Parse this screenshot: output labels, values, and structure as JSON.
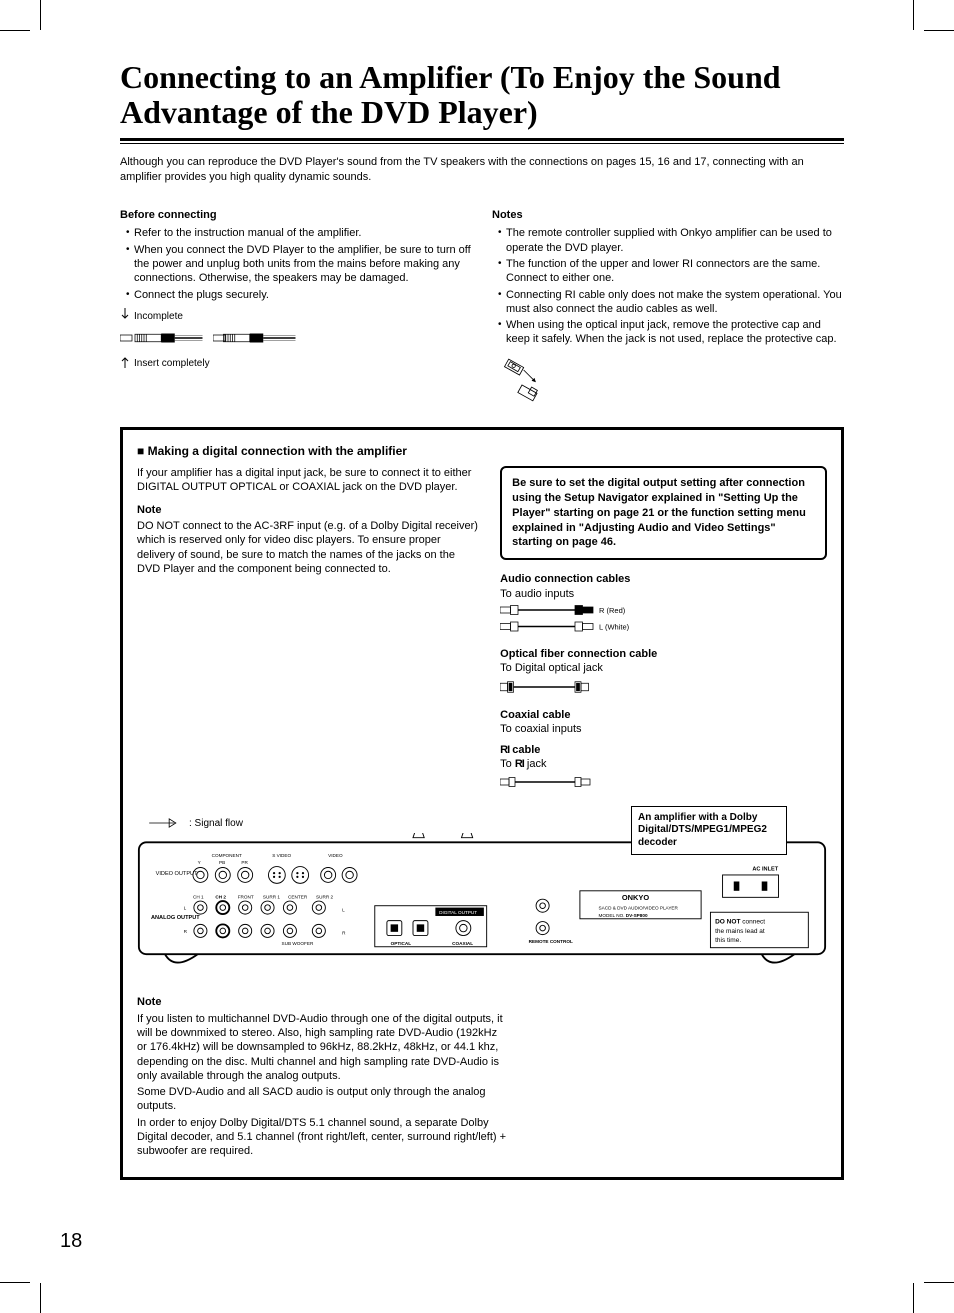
{
  "title": "Connecting to an Amplifier (To Enjoy the Sound Advantage of the DVD Player)",
  "intro": "Although you can reproduce the DVD Player's sound from the TV speakers with the connections on pages 15, 16 and 17, connecting with an amplifier provides you high quality dynamic sounds.",
  "before": {
    "heading": "Before connecting",
    "items": [
      "Refer to the instruction manual of the amplifier.",
      "When you connect the DVD Player to the amplifier, be sure to turn off the power and unplug both units from the mains before making any connections. Otherwise, the speakers may be damaged.",
      "Connect the plugs securely."
    ],
    "plug_incomplete": "Incomplete",
    "plug_complete": "Insert completely"
  },
  "notes": {
    "heading": "Notes",
    "items": [
      "The remote controller supplied with Onkyo amplifier can be used to operate the DVD player.",
      "The function of the upper and lower RI connectors are the same. Connect to either one.",
      "Connecting RI cable only does not make the system operational. You must also connect the audio cables as well.",
      "When using the optical input jack, remove the protective cap and keep it safely. When the jack is not used, replace the protective cap."
    ]
  },
  "digital": {
    "heading": "Making a digital connection with the amplifier",
    "body": "If your amplifier has a digital input jack, be sure to connect it to either DIGITAL OUTPUT OPTICAL or COAXIAL jack on the DVD player.",
    "note_label": "Note",
    "note_body": "DO NOT connect to the AC-3RF input (e.g. of a Dolby Digital receiver) which is reserved only for video disc players. To ensure proper delivery of sound, be sure to match the names of the jacks on the DVD Player and the component being connected to.",
    "callout": "Be sure to set the digital output setting after connection using the Setup Navigator explained in \"Setting Up the Player\" starting on page 21 or the function setting menu explained in \"Adjusting Audio and Video Settings\" starting on page 46.",
    "cables": {
      "audio_title": "Audio connection cables",
      "audio_sub": "To audio inputs",
      "r_label": "R (Red)",
      "l_label": "L (White)",
      "optical_title": "Optical fiber connection cable",
      "optical_sub": "To Digital optical jack",
      "coax_title": "Coaxial cable",
      "coax_sub": "To coaxial inputs",
      "ri_title": "RI cable",
      "ri_sub": "To RI jack"
    },
    "signal_flow": ": Signal flow",
    "amp_box": "An amplifier with a Dolby Digital/DTS/MPEG1/MPEG2 decoder"
  },
  "panel": {
    "brand": "ONKYO",
    "desc": "SACD & DVD AUDIO/VIDEO PLAYER",
    "model_label": "MODEL NO.",
    "model": "DV-SP800",
    "ac_inlet": "AC INLET",
    "do_not": "DO NOT connect the mains lead at this time.",
    "video_output": "VIDEO OUTPUT",
    "analog_output": "ANALOG OUTPUT",
    "digital_output": "DIGITAL OUTPUT",
    "remote_control": "REMOTE CONTROL",
    "optical": "OPTICAL",
    "coaxial": "COAXIAL",
    "labels": {
      "component": "COMPONENT",
      "y": "Y",
      "pb": "PB",
      "pr": "PR",
      "svideo": "S VIDEO",
      "video": "VIDEO",
      "ch1": "CH 1",
      "ch2": "CH 2",
      "front": "FRONT",
      "surr1": "SURR 1",
      "center": "CENTER",
      "surr2": "SURR 2",
      "l": "L",
      "r": "R",
      "sub": "SUB WOOFER"
    }
  },
  "bottom_note": {
    "heading": "Note",
    "p1": "If you listen to multichannel DVD-Audio through one of the digital outputs, it will be downmixed to stereo. Also, high sampling rate DVD-Audio (192kHz or 176.4kHz) will be downsampled to 96kHz, 88.2kHz, 48kHz, or 44.1 khz, depending on the disc. Multi channel and high sampling rate DVD-Audio is only available through the analog outputs.",
    "p2": "Some DVD-Audio and all SACD audio is output only through the analog outputs.",
    "p3": "In order to enjoy Dolby Digital/DTS 5.1 channel sound, a separate Dolby Digital decoder, and 5.1 channel (front right/left, center, surround right/left) + subwoofer are required."
  },
  "page_number": "18"
}
